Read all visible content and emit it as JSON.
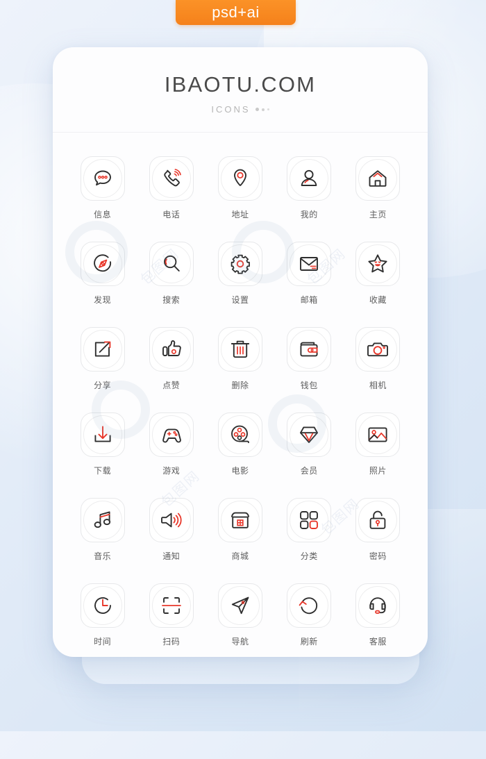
{
  "badge": {
    "label": "psd+ai"
  },
  "card": {
    "title": "IBAOTU.COM",
    "subtitle": "ICONS"
  },
  "colors": {
    "accent_orange": "#f5811b",
    "icon_red": "#e8372a",
    "icon_dark": "#2f2f2f",
    "label_gray": "#5d5d5d",
    "card_bg": "#fdfdfe",
    "page_bg": "#dfe9f6"
  },
  "icons": [
    {
      "label": "信息",
      "name": "message-icon"
    },
    {
      "label": "电话",
      "name": "phone-icon"
    },
    {
      "label": "地址",
      "name": "location-icon"
    },
    {
      "label": "我的",
      "name": "user-icon"
    },
    {
      "label": "主页",
      "name": "home-icon"
    },
    {
      "label": "发现",
      "name": "compass-icon"
    },
    {
      "label": "搜索",
      "name": "search-icon"
    },
    {
      "label": "设置",
      "name": "gear-icon"
    },
    {
      "label": "邮箱",
      "name": "mail-icon"
    },
    {
      "label": "收藏",
      "name": "star-icon"
    },
    {
      "label": "分享",
      "name": "share-icon"
    },
    {
      "label": "点赞",
      "name": "thumbs-up-icon"
    },
    {
      "label": "删除",
      "name": "trash-icon"
    },
    {
      "label": "钱包",
      "name": "wallet-icon"
    },
    {
      "label": "相机",
      "name": "camera-icon"
    },
    {
      "label": "下载",
      "name": "download-icon"
    },
    {
      "label": "游戏",
      "name": "gamepad-icon"
    },
    {
      "label": "电影",
      "name": "film-reel-icon"
    },
    {
      "label": "会员",
      "name": "vip-diamond-icon"
    },
    {
      "label": "照片",
      "name": "photo-icon"
    },
    {
      "label": "音乐",
      "name": "music-icon"
    },
    {
      "label": "通知",
      "name": "speaker-icon"
    },
    {
      "label": "商城",
      "name": "shop-icon"
    },
    {
      "label": "分类",
      "name": "category-grid-icon"
    },
    {
      "label": "密码",
      "name": "lock-icon"
    },
    {
      "label": "时间",
      "name": "clock-icon"
    },
    {
      "label": "扫码",
      "name": "scan-code-icon"
    },
    {
      "label": "导航",
      "name": "navigation-icon"
    },
    {
      "label": "刷新",
      "name": "refresh-icon"
    },
    {
      "label": "客服",
      "name": "headset-icon"
    }
  ],
  "watermark": {
    "mark": "包图网"
  }
}
